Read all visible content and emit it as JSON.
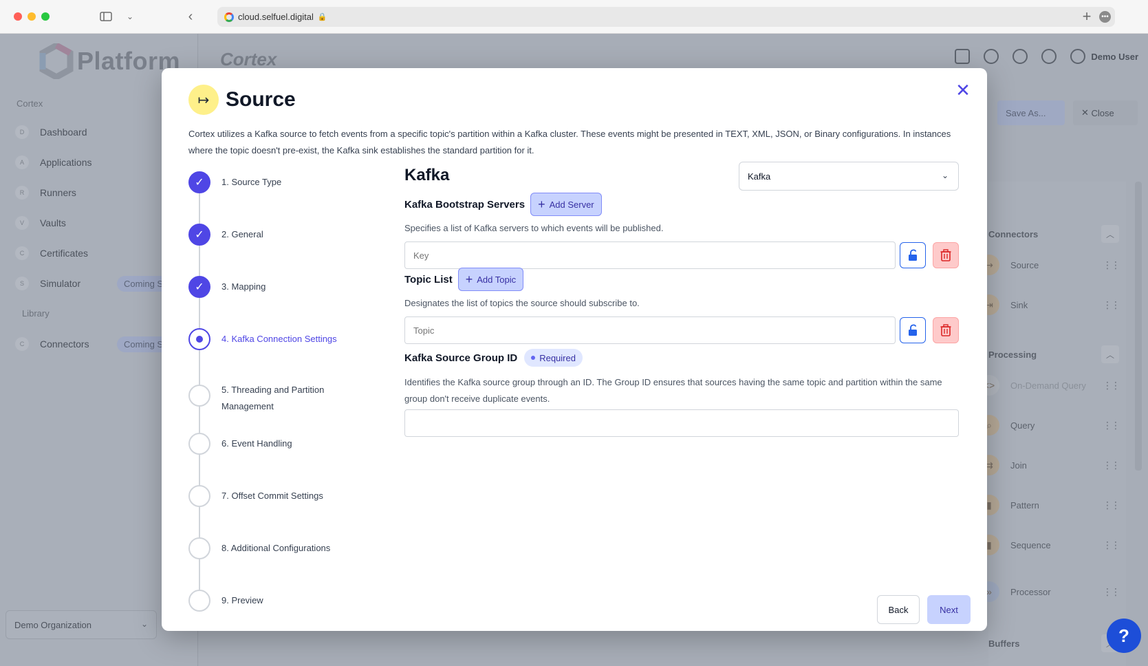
{
  "browser": {
    "url": "cloud.selfuel.digital"
  },
  "sidebar": {
    "brand": "Platform",
    "section_cortex": "Cortex",
    "items": [
      {
        "letter": "D",
        "label": "Dashboard"
      },
      {
        "letter": "A",
        "label": "Applications"
      },
      {
        "letter": "R",
        "label": "Runners"
      },
      {
        "letter": "V",
        "label": "Vaults"
      },
      {
        "letter": "C",
        "label": "Certificates"
      },
      {
        "letter": "S",
        "label": "Simulator",
        "badge": "Coming Soon"
      }
    ],
    "section_library": "Library",
    "library_items": [
      {
        "letter": "C",
        "label": "Connectors",
        "badge": "Coming Soon"
      }
    ],
    "organization": "Demo Organization"
  },
  "header": {
    "app_logo": "Cortex",
    "user": "Demo User",
    "save_as": "Save As...",
    "close": "Close"
  },
  "right_panel": {
    "connectors_title": "Connectors",
    "connectors": [
      "Source",
      "Sink"
    ],
    "processing_title": "Processing",
    "processing": [
      "On-Demand Query",
      "Query",
      "Join",
      "Pattern",
      "Sequence",
      "Processor"
    ],
    "buffers_title": "Buffers"
  },
  "modal": {
    "title": "Source",
    "icon": "arrow-right-to-line-icon",
    "description": "Cortex utilizes a Kafka source to fetch events from a specific topic's partition within a Kafka cluster. These events might be presented in TEXT, XML, JSON, or Binary configurations. In instances where the topic doesn't pre-exist, the Kafka sink establishes the standard partition for it.",
    "steps": [
      {
        "label": "1. Source Type",
        "state": "done"
      },
      {
        "label": "2. General",
        "state": "done"
      },
      {
        "label": "3. Mapping",
        "state": "done"
      },
      {
        "label": "4. Kafka Connection Settings",
        "state": "current"
      },
      {
        "label": "5. Threading and Partition Management",
        "state": "todo"
      },
      {
        "label": "6. Event Handling",
        "state": "todo"
      },
      {
        "label": "7. Offset Commit Settings",
        "state": "todo"
      },
      {
        "label": "8. Additional Configurations",
        "state": "todo"
      },
      {
        "label": "9. Preview",
        "state": "todo"
      }
    ],
    "form": {
      "title": "Kafka",
      "type_selected": "Kafka",
      "bootstrap": {
        "label": "Kafka Bootstrap Servers",
        "add_label": "Add Server",
        "help": "Specifies a list of Kafka servers to which events will be published.",
        "placeholder": "Key"
      },
      "topics": {
        "label": "Topic List",
        "add_label": "Add Topic",
        "help": "Designates the list of topics the source should subscribe to.",
        "placeholder": "Topic"
      },
      "group_id": {
        "label": "Kafka Source Group ID",
        "badge": "Required",
        "help": "Identifies the Kafka source group through an ID. The Group ID ensures that sources having the same topic and partition within the same group don't receive duplicate events.",
        "value": ""
      }
    },
    "back_label": "Back",
    "next_label": "Next"
  },
  "colors": {
    "accent": "#4f46e5",
    "head_icon_bg": "#fef08a",
    "danger_bg": "#fecaca"
  }
}
